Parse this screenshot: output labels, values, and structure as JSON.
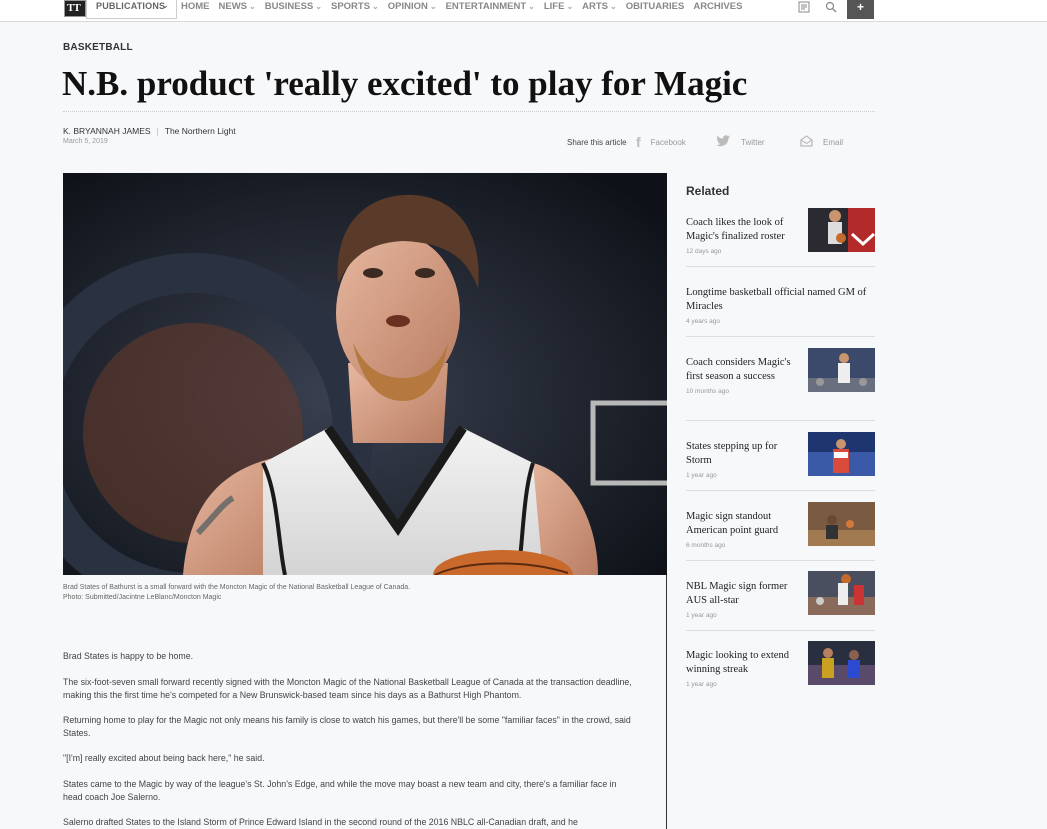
{
  "topbar": {
    "publications_label": "PUBLICATIONS",
    "nav": [
      "HOME",
      "NEWS",
      "BUSINESS",
      "SPORTS",
      "OPINION",
      "ENTERTAINMENT",
      "LIFE",
      "ARTS",
      "OBITUARIES",
      "ARCHIVES"
    ],
    "nav_has_dropdown": [
      false,
      true,
      true,
      true,
      true,
      true,
      true,
      true,
      false,
      false
    ]
  },
  "article": {
    "category": "BASKETBALL",
    "headline": "N.B. product 'really excited' to play for Magic",
    "author": "K. BRYANNAH JAMES",
    "publication": "The Northern Light",
    "date": "March 5, 2019",
    "share_label": "Share this article",
    "share": {
      "facebook": "Facebook",
      "twitter": "Twitter",
      "email": "Email"
    },
    "caption_line1": "Brad States of Bathurst is a small forward with the Moncton Magic of the National Basketball League of Canada.",
    "caption_line2": "Photo: Submitted/Jacintne LeBlanc/Moncton Magic",
    "paragraphs": [
      "Brad States is happy to be home.",
      "The six-foot-seven small forward recently signed with the Moncton Magic of the National Basketball League of Canada at the transaction deadline, making this the first time he's competed for a New Brunswick-based team since his days as a Bathurst High Phantom.",
      "Returning home to play for the Magic not only means his family is close to watch his games, but there'll be some \"familiar faces\" in the crowd, said States.",
      "\"[I'm] really excited about being back here,\" he said.",
      "States came to the Magic by way of the league's St. John's Edge, and while the move may boast a new team and city, there's a familiar face in head coach Joe Salerno.",
      "Salerno drafted States to the Island Storm of Prince Edward Island in the second round of the 2016 NBLC all-Canadian draft, and he"
    ]
  },
  "related": {
    "title": "Related",
    "items": [
      {
        "title": "Coach likes the look of Magic's finalized roster",
        "time": "12 days ago"
      },
      {
        "title": "Longtime basketball official named GM of Miracles",
        "time": "4 years ago"
      },
      {
        "title": "Coach considers Magic's first season a success",
        "time": "10 months ago"
      },
      {
        "title": "States stepping up for Storm",
        "time": "1 year ago"
      },
      {
        "title": "Magic sign standout American point guard",
        "time": "6 months ago"
      },
      {
        "title": "NBL Magic sign former AUS all-star",
        "time": "1 year ago"
      },
      {
        "title": "Magic looking to extend winning streak",
        "time": "1 year ago"
      }
    ]
  },
  "colors": {
    "headline": "#111111",
    "nav": "#888888",
    "background": "#f7f8fa"
  },
  "icons": [
    "logo-icon",
    "chevron-down-icon",
    "reader-icon",
    "search-icon",
    "plus-icon",
    "facebook-icon",
    "twitter-icon",
    "email-icon"
  ]
}
